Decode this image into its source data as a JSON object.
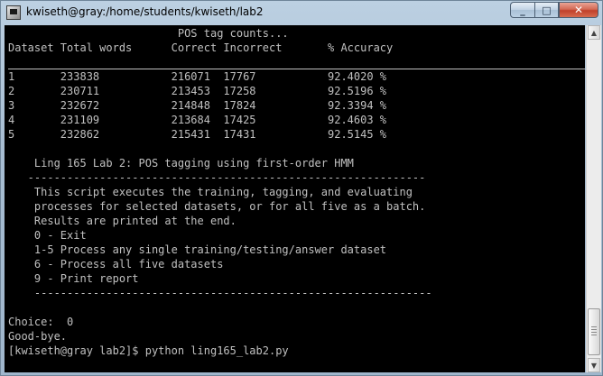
{
  "window": {
    "title": "kwiseth@gray:/home/students/kwiseth/lab2",
    "icon": "putty-terminal-icon",
    "controls": {
      "minimize": "_",
      "maximize": "□",
      "close": "✕"
    }
  },
  "terminal": {
    "lines": [
      "                          POS tag counts...",
      "Dataset Total words      Correct Incorrect       % Accuracy",
      "",
      "1       233838           216071  17767           92.4020 %",
      "2       230711           213453  17258           92.5196 %",
      "3       232672           214848  17824           92.3394 %",
      "4       231109           213684  17425           92.4603 %",
      "5       232862           215431  17431           92.5145 %",
      "",
      "    Ling 165 Lab 2: POS tagging using first-order HMM",
      "   -------------------------------------------------------------",
      "    This script executes the training, tagging, and evaluating",
      "    processes for selected datasets, or for all five as a batch.",
      "    Results are printed at the end.",
      "    0 - Exit",
      "    1-5 Process any single training/testing/answer dataset",
      "    6 - Process all five datasets",
      "    9 - Print report",
      "    -------------------------------------------------------------",
      "",
      "Choice:  0",
      "Good-bye.",
      "[kwiseth@gray lab2]$ python ling165_lab2.py"
    ]
  },
  "scrollbar": {
    "up": "▲",
    "down": "▼"
  }
}
